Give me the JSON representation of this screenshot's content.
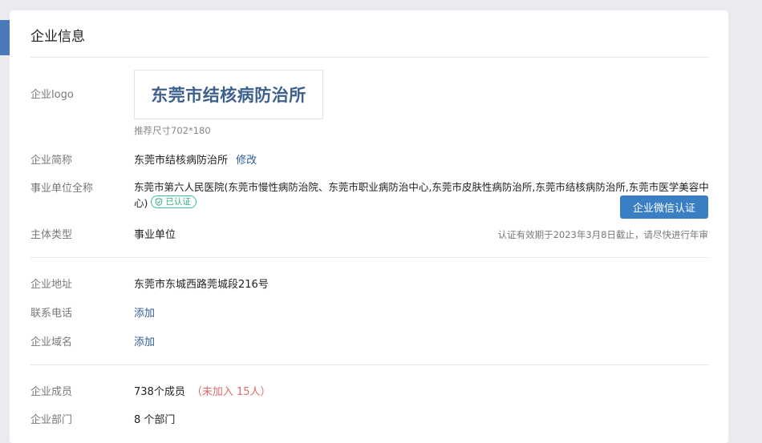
{
  "card": {
    "title": "企业信息"
  },
  "logo": {
    "label": "企业logo",
    "text": "东莞市结核病防治所",
    "hint": "推荐尺寸702*180"
  },
  "short_name": {
    "label": "企业简称",
    "value": "东莞市结核病防治所",
    "edit_label": "修改"
  },
  "full_name": {
    "label": "事业单位全称",
    "value": "东莞市第六人民医院(东莞市慢性病防治院、东莞市职业病防治中心,东莞市皮肤性病防治所,东莞市结核病防治所,东莞市医学美容中心)",
    "verified_badge": "已认证"
  },
  "wechat_verify": {
    "button_label": "企业微信认证"
  },
  "entity_type": {
    "label": "主体类型",
    "value": "事业单位",
    "expiry_note": "认证有效期于2023年3月8日截止，请尽快进行年审"
  },
  "address": {
    "label": "企业地址",
    "value": "东莞市东城西路莞城段216号"
  },
  "phone": {
    "label": "联系电话",
    "action": "添加"
  },
  "domain": {
    "label": "企业域名",
    "action": "添加"
  },
  "members": {
    "label": "企业成员",
    "value": "738个成员",
    "not_joined": "（未加入 15人）"
  },
  "departments": {
    "label": "企业部门",
    "value": "8 个部门"
  },
  "colors": {
    "accent": "#3a7fc4",
    "link": "#2f5c9a",
    "verified": "#2fae7a",
    "warning": "#e06868"
  }
}
